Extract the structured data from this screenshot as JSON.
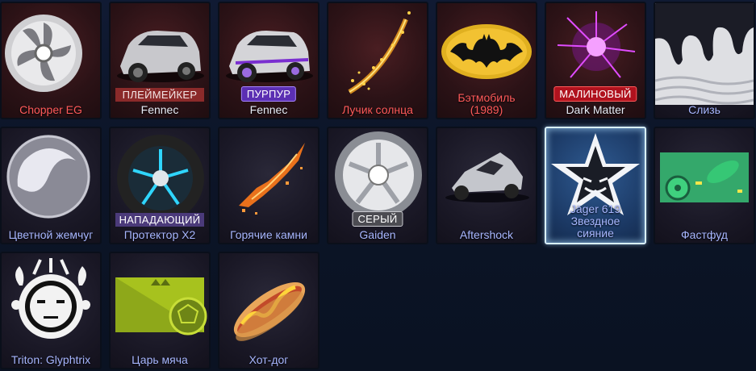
{
  "items": [
    {
      "name": "Chopper EG",
      "badge": ""
    },
    {
      "name": "Fennec",
      "badge": "ПЛЕЙМЕЙКЕР"
    },
    {
      "name": "Fennec",
      "badge": "ПУРПУР"
    },
    {
      "name": "Лучик солнца",
      "badge": ""
    },
    {
      "name": "Бэтмобиль (1989)",
      "badge": ""
    },
    {
      "name": "Dark Matter",
      "badge": "МАЛИНОВЫЙ"
    },
    {
      "name": "Слизь",
      "badge": ""
    },
    {
      "name": "Цветной жемчуг",
      "badge": ""
    },
    {
      "name": "Протектор X2",
      "badge": "НАПАДАЮЩИЙ"
    },
    {
      "name": "Горячие камни",
      "badge": ""
    },
    {
      "name": "Gaiden",
      "badge": "СЕРЫЙ"
    },
    {
      "name": "Aftershock",
      "badge": ""
    },
    {
      "name": "Jäger 619 Звездное сияние",
      "line1": "Jäger 619",
      "line2": "Звездное",
      "line3": "сияние",
      "badge": ""
    },
    {
      "name": "Фастфуд",
      "badge": ""
    },
    {
      "name": "Triton: Glyphtrix",
      "badge": ""
    },
    {
      "name": "Царь мяча",
      "badge": ""
    },
    {
      "name": "Хот-дог",
      "badge": ""
    }
  ],
  "batmobile_line1": "Бэтмобиль",
  "batmobile_line2": "(1989)",
  "colors": {
    "red_label": "#ff5a5a",
    "blue_label": "#a7b6ff",
    "selected_border": "#d9f0ff"
  }
}
